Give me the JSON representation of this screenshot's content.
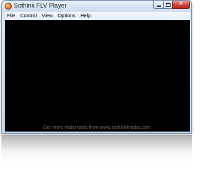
{
  "window": {
    "title": "Sothink FLV Player",
    "controls": {
      "minimize_icon": "minimize-icon",
      "maximize_icon": "maximize-icon",
      "close_glyph": "✕"
    }
  },
  "menubar": {
    "items": [
      {
        "label": "File"
      },
      {
        "label": "Control"
      },
      {
        "label": "View"
      },
      {
        "label": "Options"
      },
      {
        "label": "Help"
      }
    ]
  },
  "video": {
    "promo_text": "Get more video tools from www.sothinkmedia.com"
  },
  "colors": {
    "video_background": "#000000",
    "close_button": "#c9453a",
    "chrome": "#c3d6ec",
    "promo_text": "#6d6d6d"
  }
}
